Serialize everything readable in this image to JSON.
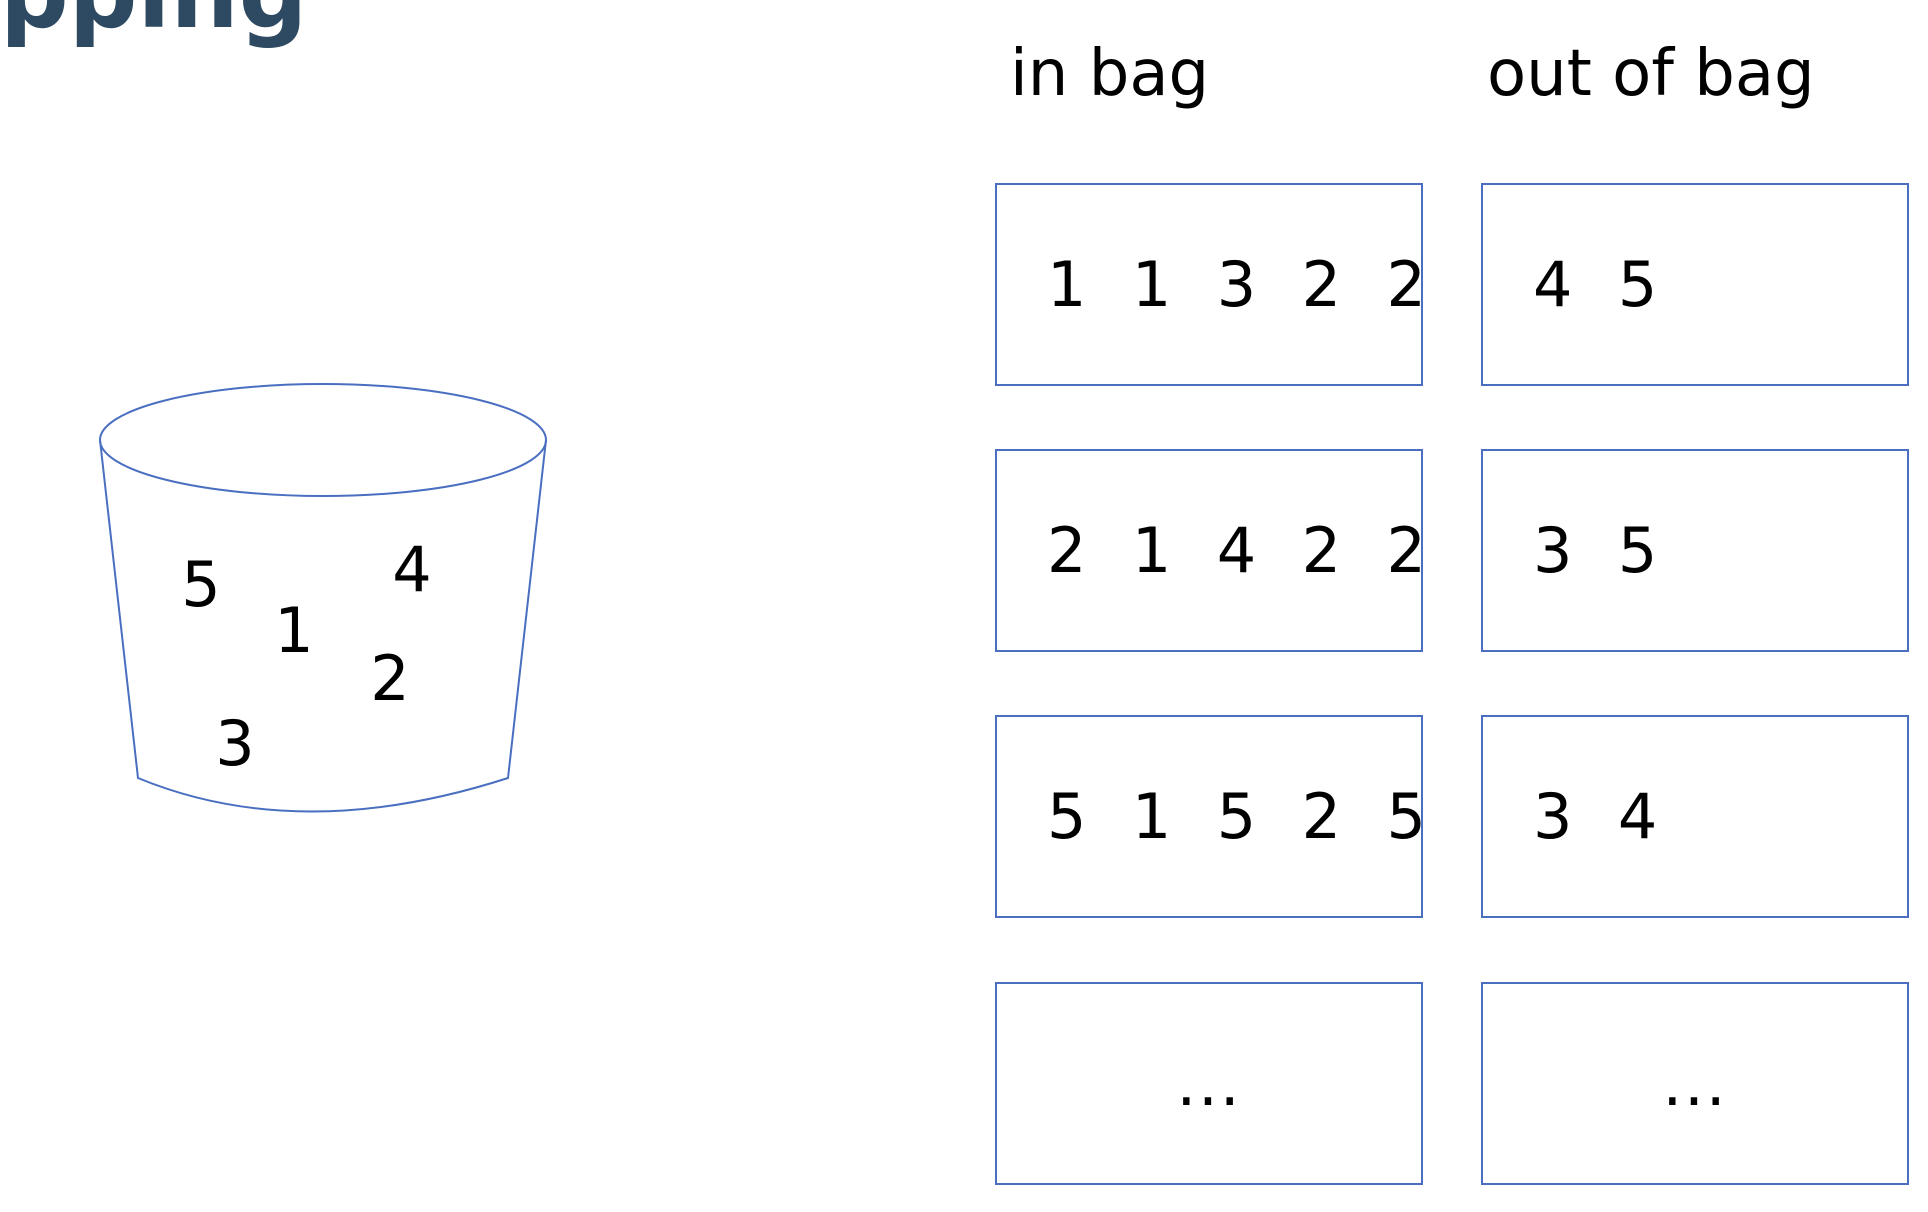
{
  "title_fragment": "pping",
  "bucket": {
    "numbers": [
      "5",
      "1",
      "4",
      "2",
      "3"
    ]
  },
  "columns": {
    "in_bag": "in bag",
    "out_of_bag": "out of bag"
  },
  "rows": [
    {
      "in_bag": "1  1  3  2  2",
      "out_of_bag": "4  5"
    },
    {
      "in_bag": "2  1  4  2  2",
      "out_of_bag": "3  5"
    },
    {
      "in_bag": "5  1  5  2  5",
      "out_of_bag": "3  4"
    },
    {
      "in_bag": "...",
      "out_of_bag": "..."
    }
  ],
  "colors": {
    "stroke": "#4a6fc1",
    "title": "#2e4a62"
  }
}
